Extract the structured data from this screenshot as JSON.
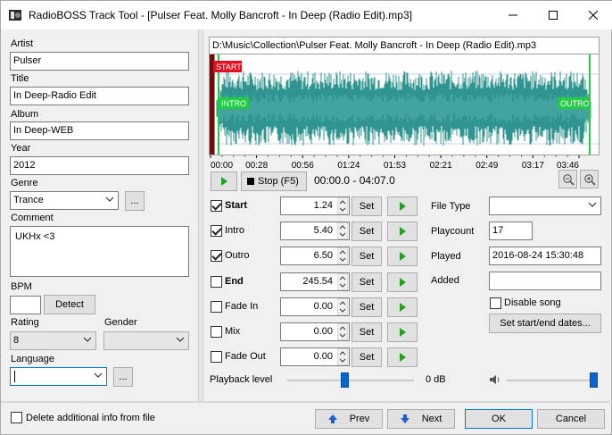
{
  "window": {
    "title": "RadioBOSS Track Tool - [Pulser Feat. Molly Bancroft - In Deep (Radio Edit).mp3]"
  },
  "left": {
    "artist_label": "Artist",
    "artist_value": "Pulser",
    "title_label": "Title",
    "title_value": "In Deep-Radio Edit",
    "album_label": "Album",
    "album_value": "In Deep-WEB",
    "year_label": "Year",
    "year_value": "2012",
    "genre_label": "Genre",
    "genre_value": "Trance",
    "ellipsis": "...",
    "comment_label": "Comment",
    "comment_value": "UKHx <3",
    "bpm_label": "BPM",
    "bpm_value": "",
    "detect_label": "Detect",
    "rating_label": "Rating",
    "rating_value": "8",
    "gender_label": "Gender",
    "gender_value": "",
    "language_label": "Language",
    "language_value": ""
  },
  "waveform": {
    "path": "D:\\Music\\Collection\\Pulser Feat. Molly Bancroft - In Deep (Radio Edit).mp3",
    "start_tag": "START",
    "intro_tag": "INTRO",
    "outro_tag": "OUTRO",
    "ticks": [
      "00:00",
      "00:28",
      "00:56",
      "01:24",
      "01:53",
      "02:21",
      "02:49",
      "03:17",
      "03:46"
    ],
    "colors": {
      "wave": "#1a8a86",
      "marker": "#22cc44",
      "start": "#e01020",
      "end": "#8b0000"
    }
  },
  "transport": {
    "stop_label": "Stop (F5)",
    "time_range": "00:00.0 - 04:07.0"
  },
  "cues": [
    {
      "label": "Start",
      "bold": true,
      "checked": true,
      "value": "1.24"
    },
    {
      "label": "Intro",
      "bold": false,
      "checked": true,
      "value": "5.40"
    },
    {
      "label": "Outro",
      "bold": false,
      "checked": true,
      "value": "6.50"
    },
    {
      "label": "End",
      "bold": true,
      "checked": false,
      "value": "245.54"
    },
    {
      "label": "Fade In",
      "bold": false,
      "checked": false,
      "value": "0.00"
    },
    {
      "label": "Mix",
      "bold": false,
      "checked": false,
      "value": "0.00"
    },
    {
      "label": "Fade Out",
      "bold": false,
      "checked": false,
      "value": "0.00"
    }
  ],
  "set_label": "Set",
  "info": {
    "file_type_label": "File Type",
    "file_type_value": "",
    "playcount_label": "Playcount",
    "playcount_value": "17",
    "played_label": "Played",
    "played_value": "2016-08-24 15:30:48",
    "added_label": "Added",
    "added_value": "",
    "disable_song_label": "Disable song",
    "set_dates_label": "Set start/end dates..."
  },
  "playback": {
    "label": "Playback level",
    "db_value": "0 dB",
    "level_fraction": 0.45,
    "volume_fraction": 1.0
  },
  "footer": {
    "delete_info_label": "Delete additional info from file",
    "prev_label": "Prev",
    "next_label": "Next",
    "ok_label": "OK",
    "cancel_label": "Cancel"
  }
}
